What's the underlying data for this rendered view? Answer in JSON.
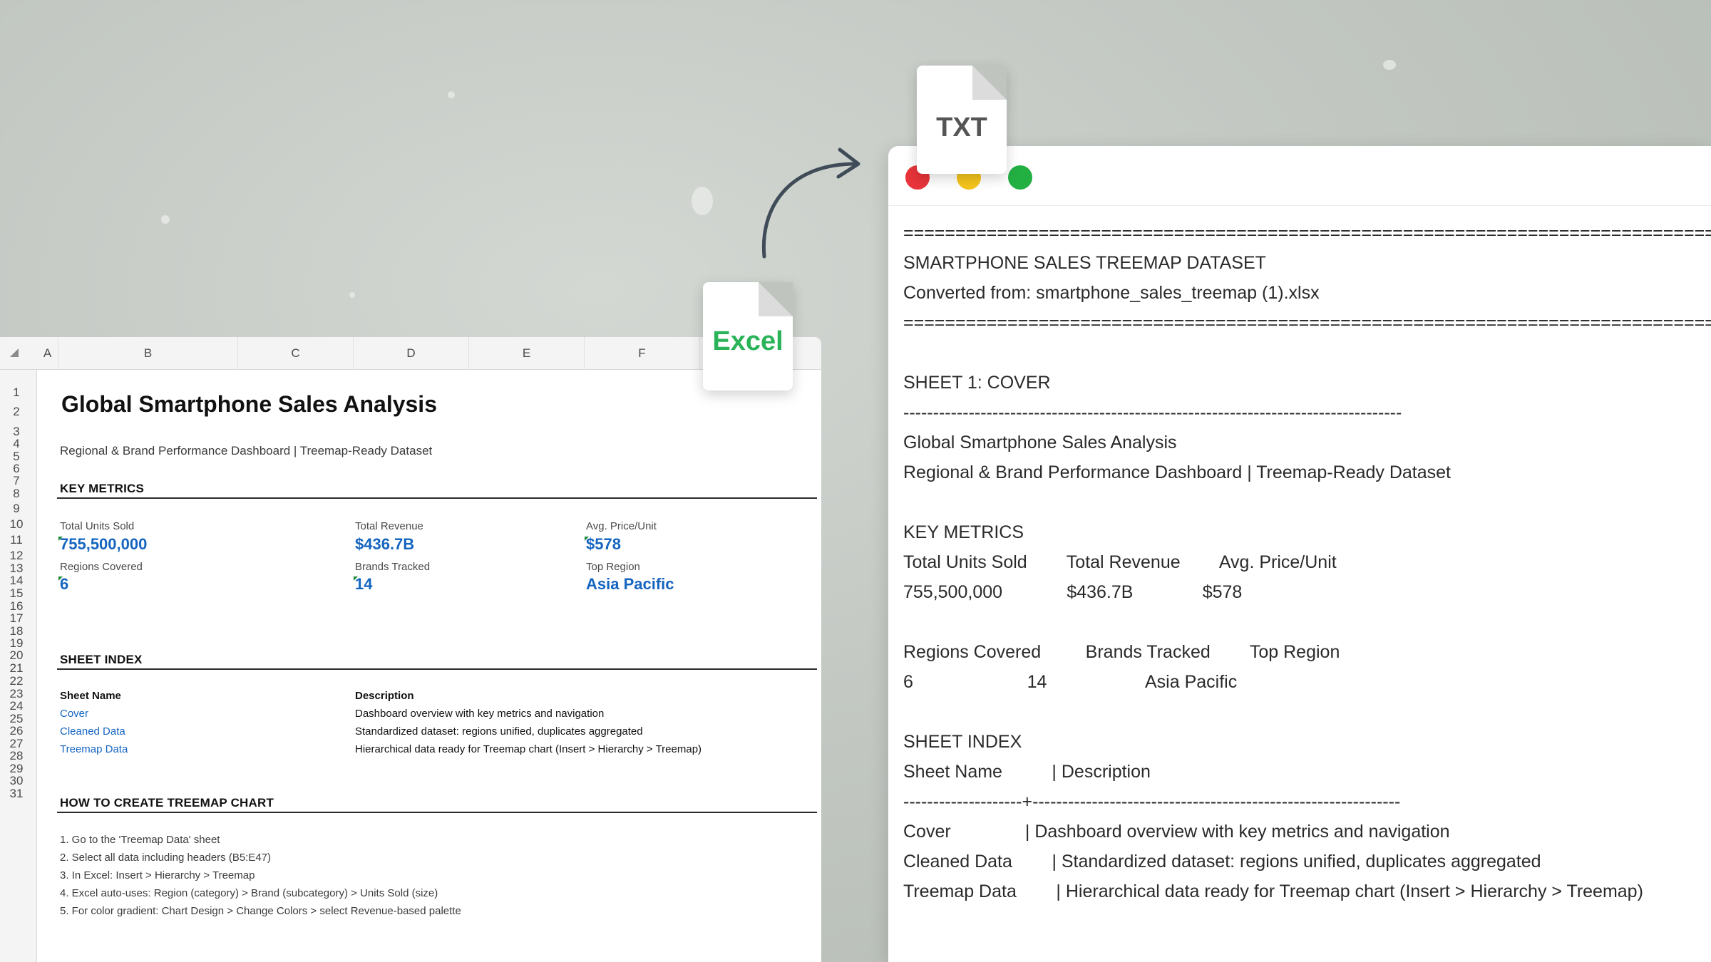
{
  "colors": {
    "accent_blue": "#1565c0",
    "excel_green": "#2bb35a",
    "close_red": "#e8343a",
    "minimize_yellow": "#f5c51c",
    "zoom_green": "#23b043"
  },
  "spreadsheet": {
    "columns": [
      "A",
      "B",
      "C",
      "D",
      "E",
      "F"
    ],
    "rows": [
      "1",
      "2",
      "3",
      "4",
      "5",
      "6",
      "7",
      "8",
      "9",
      "10",
      "11",
      "12",
      "13",
      "14",
      "15",
      "16",
      "17",
      "18",
      "19",
      "20",
      "21",
      "22",
      "23",
      "24",
      "25",
      "26",
      "27",
      "28",
      "29",
      "30",
      "31"
    ],
    "title": "Global Smartphone Sales Analysis",
    "subtitle": "Regional & Brand Performance Dashboard | Treemap-Ready Dataset",
    "key_metrics_heading": "KEY METRICS",
    "metrics": [
      {
        "label": "Total Units Sold",
        "value": "755,500,000"
      },
      {
        "label": "Total Revenue",
        "value": "$436.7B"
      },
      {
        "label": "Avg. Price/Unit",
        "value": "$578"
      },
      {
        "label": "Regions Covered",
        "value": "6"
      },
      {
        "label": "Brands Tracked",
        "value": "14"
      },
      {
        "label": "Top Region",
        "value": "Asia Pacific"
      }
    ],
    "sheet_index_heading": "SHEET INDEX",
    "index_headers": {
      "name": "Sheet Name",
      "description": "Description"
    },
    "index_rows": [
      {
        "name": "Cover",
        "description": "Dashboard overview with key metrics and navigation"
      },
      {
        "name": "Cleaned Data",
        "description": "Standardized dataset: regions unified, duplicates aggregated"
      },
      {
        "name": "Treemap Data",
        "description": "Hierarchical data ready for Treemap chart (Insert > Hierarchy > Treemap)"
      }
    ],
    "howto_heading": "HOW TO CREATE TREEMAP CHART",
    "steps": [
      "1. Go to the 'Treemap Data' sheet",
      "2. Select all data including headers (B5:E47)",
      "3. In Excel: Insert > Hierarchy > Treemap",
      "4. Excel auto-uses: Region (category) > Brand (subcategory) > Units Sold (size)",
      "5. For color gradient: Chart Design > Change Colors > select Revenue-based palette"
    ]
  },
  "excel_icon": {
    "label": "Excel",
    "icon": "excel-file-icon"
  },
  "txt_icon": {
    "label": "TXT",
    "icon": "txt-file-icon"
  },
  "arrow_icon": "curved-arrow-icon",
  "txt_window": {
    "lines": [
      "=================================================================================",
      "SMARTPHONE SALES TREEMAP DATASET",
      "Converted from: smartphone_sales_treemap (1).xlsx",
      "=================================================================================",
      "",
      "SHEET 1: COVER",
      "------------------------------------------------------------------------------------",
      "Global Smartphone Sales Analysis",
      "Regional & Brand Performance Dashboard | Treemap-Ready Dataset",
      "",
      "KEY METRICS",
      "Total Units Sold        Total Revenue        Avg. Price/Unit",
      "755,500,000             $436.7B              $578",
      "",
      "Regions Covered         Brands Tracked        Top Region",
      "6                       14                    Asia Pacific",
      "",
      "SHEET INDEX",
      "Sheet Name          | Description",
      "--------------------+--------------------------------------------------------------",
      "Cover               | Dashboard overview with key metrics and navigation",
      "Cleaned Data        | Standardized dataset: regions unified, duplicates aggregated",
      "Treemap Data        | Hierarchical data ready for Treemap chart (Insert > Hierarchy > Treemap)"
    ]
  }
}
